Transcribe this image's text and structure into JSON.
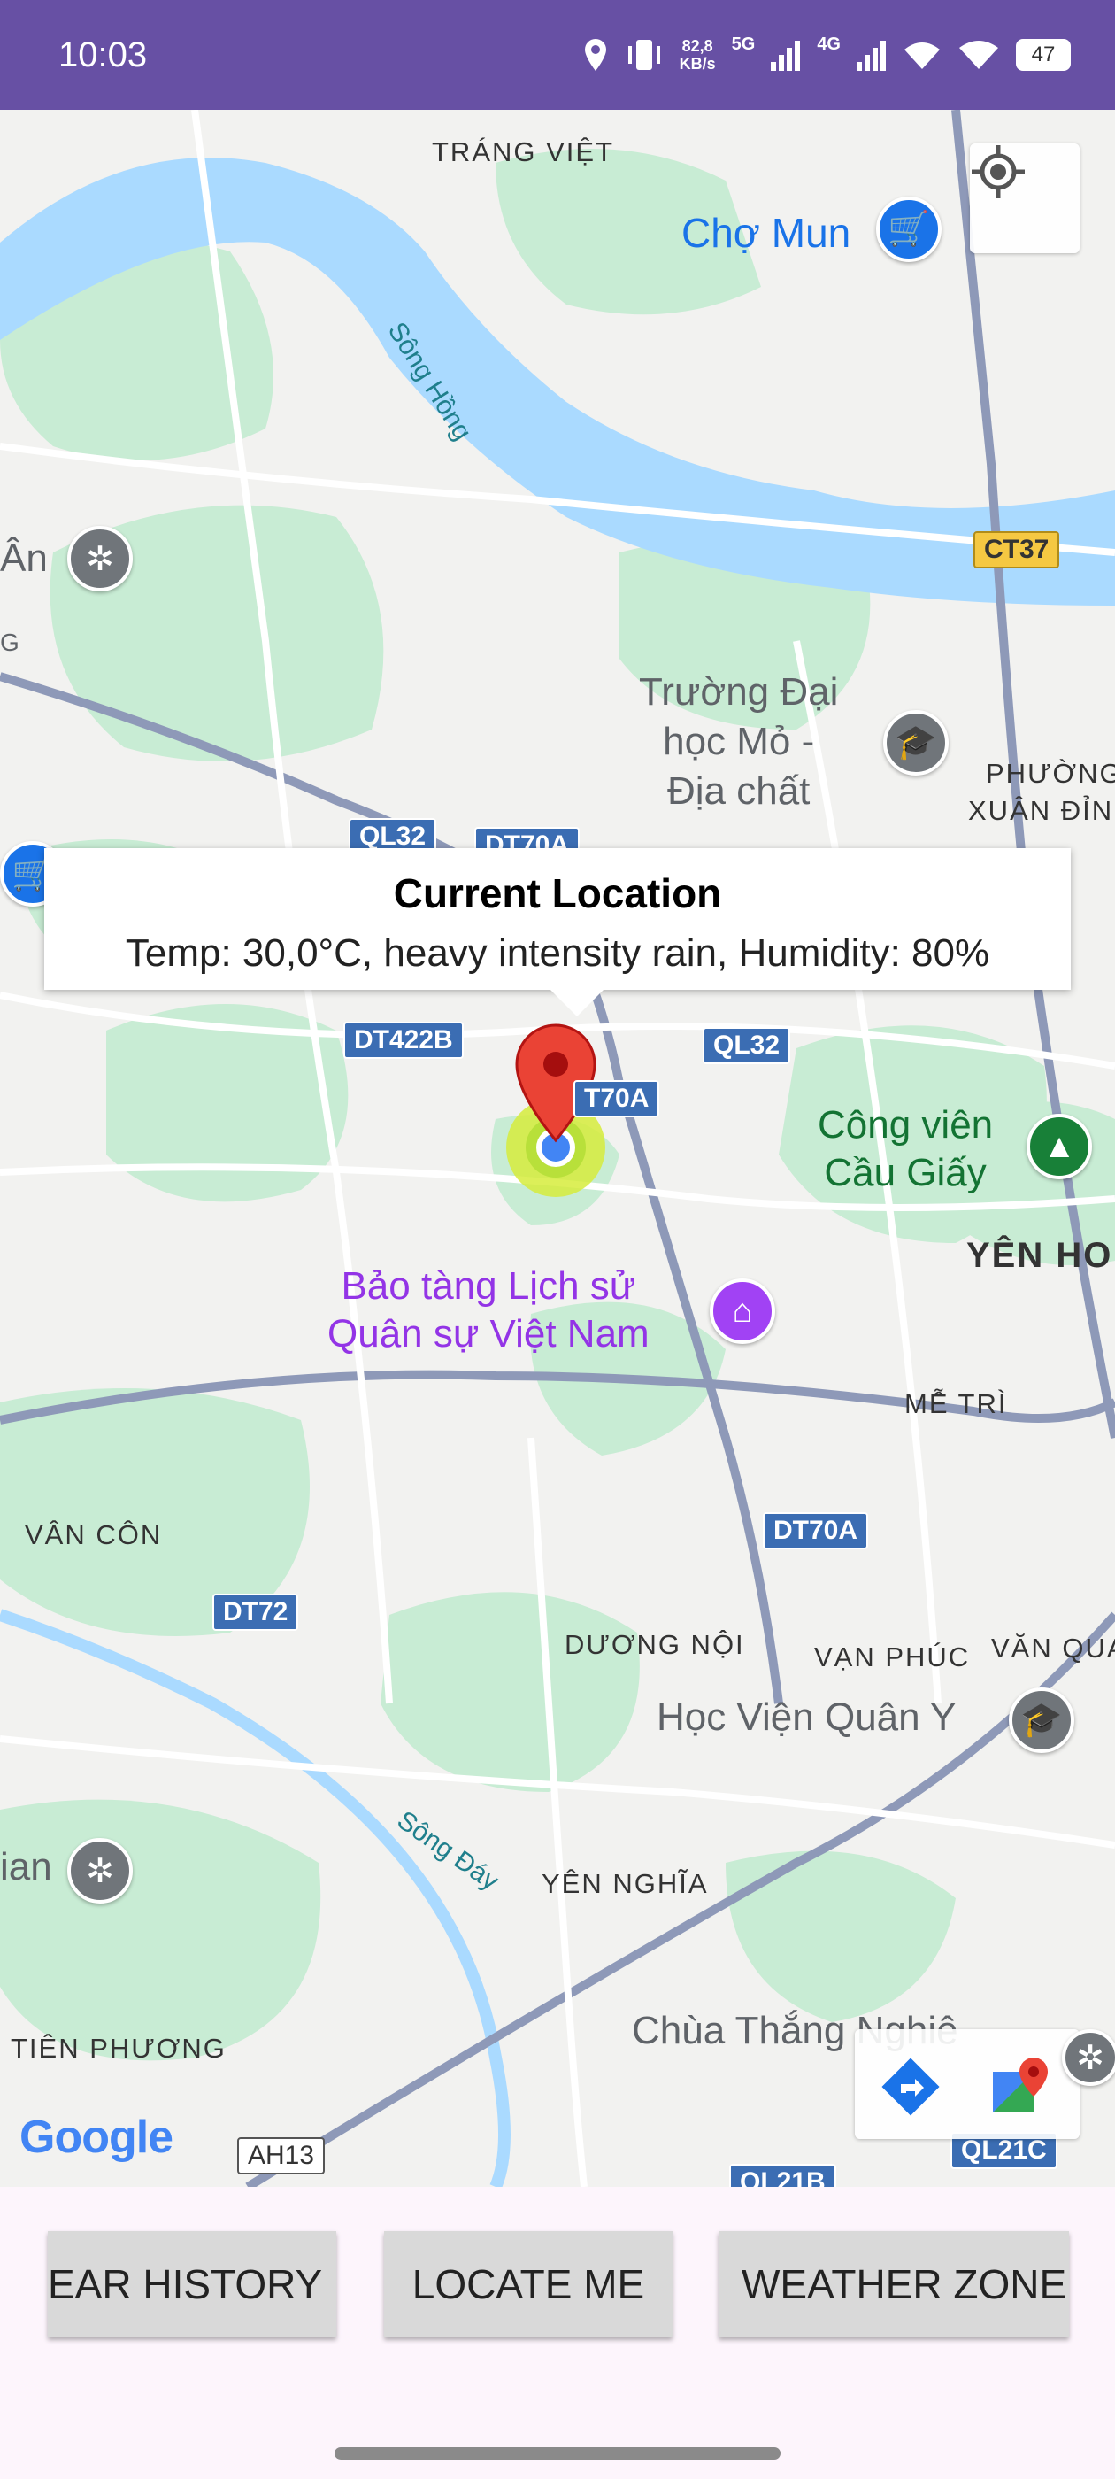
{
  "status_bar": {
    "time": "10:03",
    "net_speed_value": "82,8",
    "net_speed_unit": "KB/s",
    "net1": "5G",
    "net2": "4G",
    "battery": "47",
    "icons": [
      "location-icon",
      "vibrate-icon",
      "signal-icon",
      "signal-icon",
      "wifi-calling-icon",
      "wifi-icon",
      "battery-icon"
    ]
  },
  "map": {
    "places": {
      "trang_viet": "TRÁNG VIỆT",
      "phuong_xuan_dinh_1": "PHƯỜNG",
      "phuong_xuan_dinh_2": "XUÂN ĐỈN",
      "yen_hoa": "YÊN HO",
      "me_tri": "MỄ TRÌ",
      "van_con": "VÂN CÔN",
      "duong_noi": "DƯƠNG NỘI",
      "van_phuc": "VẠN PHÚC",
      "van_quan": "VĂN QUA",
      "yen_nghia": "YÊN NGHĨA",
      "tien_phuong": "TIÊN PHƯƠNG",
      "an": "Ân",
      "ian": "ian",
      "g": "G"
    },
    "rivers": {
      "song_hong": "Sông Hồng",
      "song_day": "Sông Đáy"
    },
    "pois": {
      "cho_mun": "Chợ Mun",
      "truong_dai_hoc": [
        "Trường Đại",
        "học Mỏ -",
        "Địa chất"
      ],
      "cong_vien": [
        "Công viên",
        "Cầu Giấy"
      ],
      "bao_tang": [
        "Bảo tàng Lịch sử",
        "Quân sự Việt Nam"
      ],
      "hoc_vien": "Học Viện Quân Y",
      "chua_thang": "Chùa Thắng Nghiê"
    },
    "road_shields": {
      "ct37": "CT37",
      "ql32_a": "QL32",
      "dt70a_a": "DT70A",
      "dt422b": "DT422B",
      "dt70a_b": "T70A",
      "ql32_b": "QL32",
      "dt70a_c": "DT70A",
      "dt72": "DT72",
      "ah13": "AH13",
      "ql21c": "QL21C",
      "ql21b": "QL21B"
    },
    "info_window": {
      "title": "Current Location",
      "body": "Temp: 30,0°C, heavy intensity rain, Humidity: 80%"
    },
    "google_logo": "Google",
    "colors": {
      "water": "#aadaff",
      "park": "#c8ecd4",
      "road": "#ffffff",
      "highway": "#8e99b8",
      "marker": "#ea4335",
      "accent": "#6750a4"
    }
  },
  "buttons": {
    "history": "EAR HISTORY",
    "locate": "LOCATE ME",
    "weather": "WEATHER ZONE"
  }
}
